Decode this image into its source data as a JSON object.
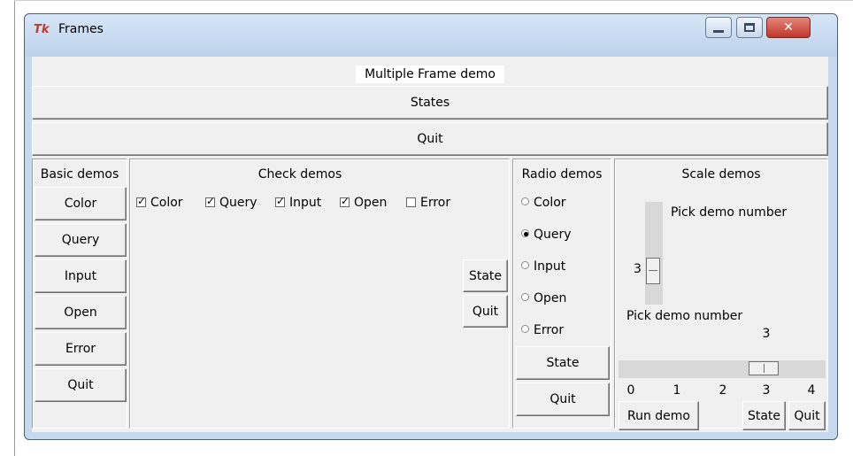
{
  "window": {
    "title": "Frames",
    "app_icon": "tk-feather-icon",
    "controls": [
      "minimize-icon",
      "maximize-icon",
      "close-icon"
    ]
  },
  "header": {
    "label": "Multiple Frame demo",
    "states_button": "States",
    "quit_button": "Quit"
  },
  "basic": {
    "label": "Basic demos",
    "buttons": [
      "Color",
      "Query",
      "Input",
      "Open",
      "Error",
      "Quit"
    ]
  },
  "check": {
    "label": "Check demos",
    "items": [
      {
        "label": "Color",
        "checked": true
      },
      {
        "label": "Query",
        "checked": true
      },
      {
        "label": "Input",
        "checked": true
      },
      {
        "label": "Open",
        "checked": true
      },
      {
        "label": "Error",
        "checked": false
      }
    ],
    "state_button": "State",
    "quit_button": "Quit"
  },
  "radio": {
    "label": "Radio demos",
    "options": [
      "Color",
      "Query",
      "Input",
      "Open",
      "Error"
    ],
    "selected": "Query",
    "state_button": "State",
    "quit_button": "Quit"
  },
  "scale": {
    "label": "Scale demos",
    "vertical": {
      "label": "Pick demo number",
      "value": "3"
    },
    "horizontal": {
      "label": "Pick demo number",
      "value": "3",
      "ticks": [
        "0",
        "1",
        "2",
        "3",
        "4"
      ]
    },
    "run_button": "Run demo",
    "state_button": "State",
    "quit_button": "Quit"
  }
}
